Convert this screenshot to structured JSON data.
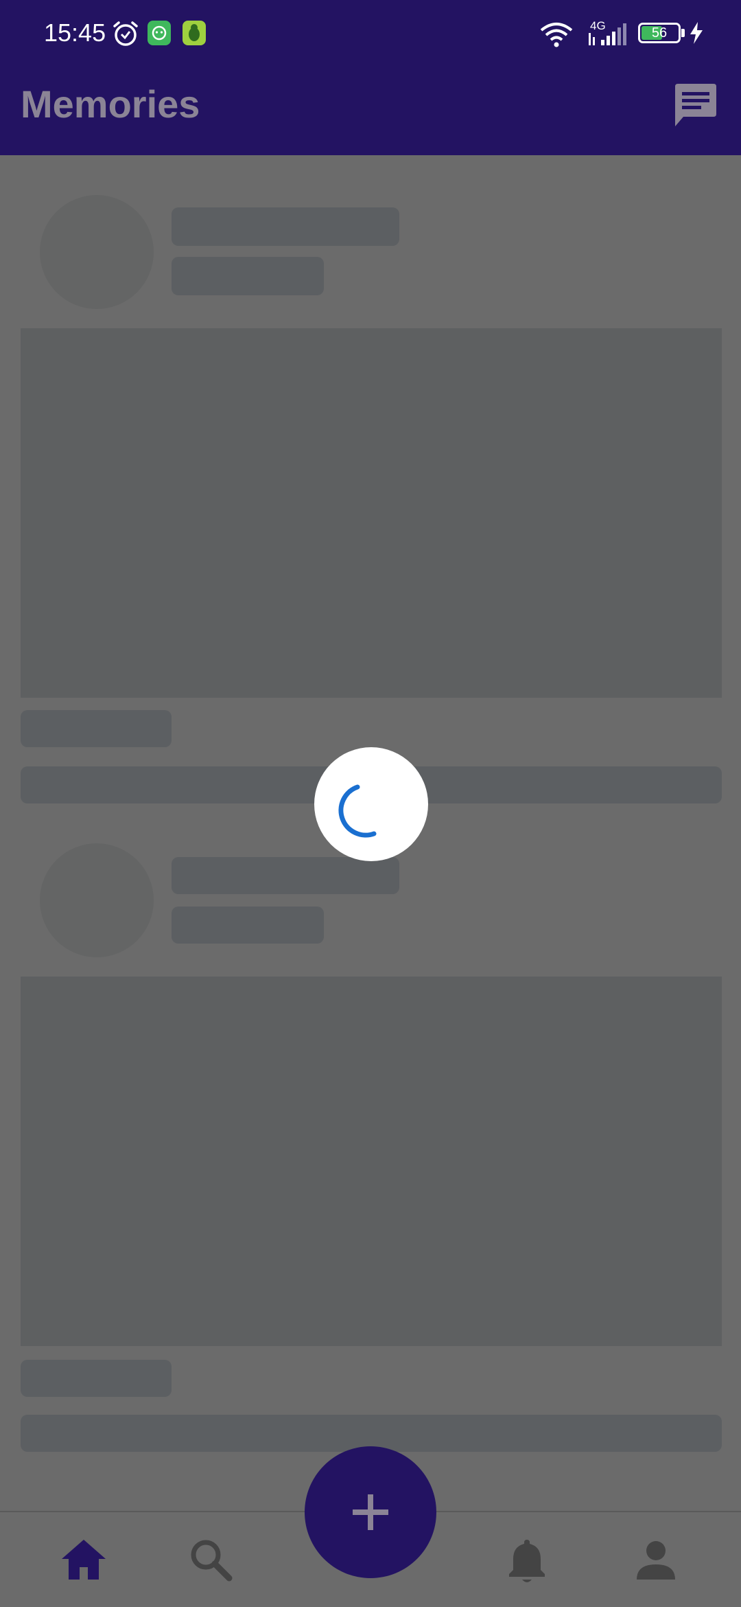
{
  "status_bar": {
    "time": "15:45",
    "network": "4G",
    "battery": "56",
    "icons": [
      "alarm-icon",
      "app-notification-icon",
      "bug-app-icon",
      "wifi-icon",
      "signal-icon",
      "battery-icon",
      "charging-icon"
    ]
  },
  "app_bar": {
    "title": "Memories",
    "chat_icon": "chat-icon"
  },
  "feed": {
    "state": "loading",
    "skeleton_posts": 2
  },
  "bottom_nav": {
    "items": [
      {
        "icon": "home-icon",
        "active": true
      },
      {
        "icon": "search-icon",
        "active": false
      },
      {
        "icon": "add-icon",
        "active": false
      },
      {
        "icon": "bell-icon",
        "active": false
      },
      {
        "icon": "profile-icon",
        "active": false
      }
    ]
  },
  "colors": {
    "primary": "#231362",
    "overlay": "#6b6b6b",
    "spinner": "#1a6fd0"
  }
}
